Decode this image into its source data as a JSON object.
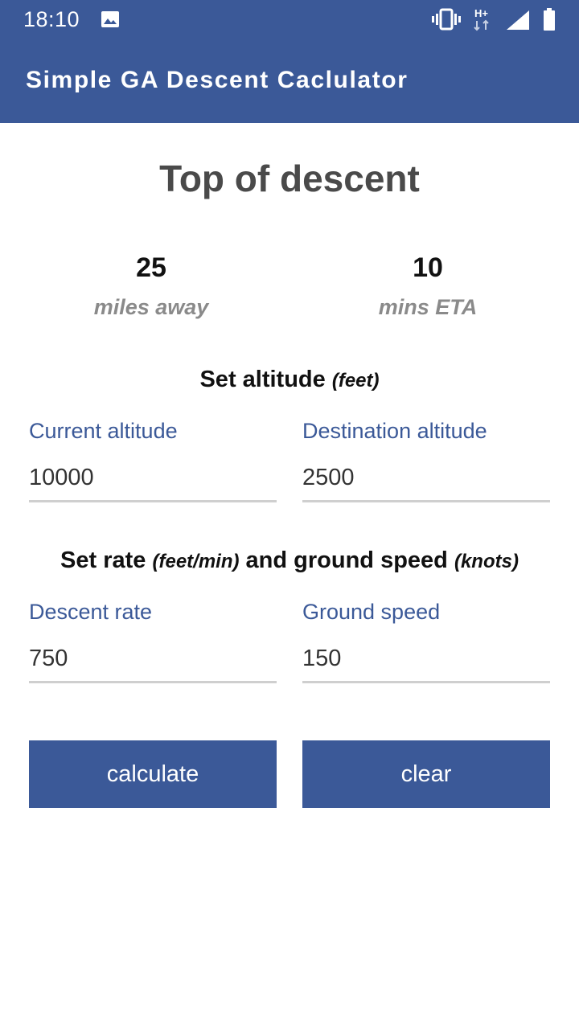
{
  "status_bar": {
    "time": "18:10",
    "icons": [
      "image-icon",
      "vibrate-icon",
      "network-hplus-icon",
      "signal-icon",
      "battery-icon"
    ],
    "network_label": "H+"
  },
  "app_bar": {
    "title": "Simple GA Descent Caclulator",
    "color": "#3b5998"
  },
  "main": {
    "title": "Top of descent",
    "results": [
      {
        "value": "25",
        "label": "miles away"
      },
      {
        "value": "10",
        "label": "mins ETA"
      }
    ],
    "altitude_section": {
      "heading": "Set altitude",
      "unit": "(feet)",
      "fields": [
        {
          "label": "Current altitude",
          "value": "10000"
        },
        {
          "label": "Destination altitude",
          "value": "2500"
        }
      ]
    },
    "rate_section": {
      "heading_part1": "Set rate",
      "unit1": "(feet/min)",
      "heading_part2": "and ground speed",
      "unit2": "(knots)",
      "fields": [
        {
          "label": "Descent rate",
          "value": "750"
        },
        {
          "label": "Ground speed",
          "value": "150"
        }
      ]
    },
    "buttons": {
      "calculate": "calculate",
      "clear": "clear"
    }
  },
  "colors": {
    "accent": "#3b5998",
    "title_text": "#4a4a4a",
    "muted_label": "#8a8a8a",
    "underline": "#cfcfcf"
  }
}
